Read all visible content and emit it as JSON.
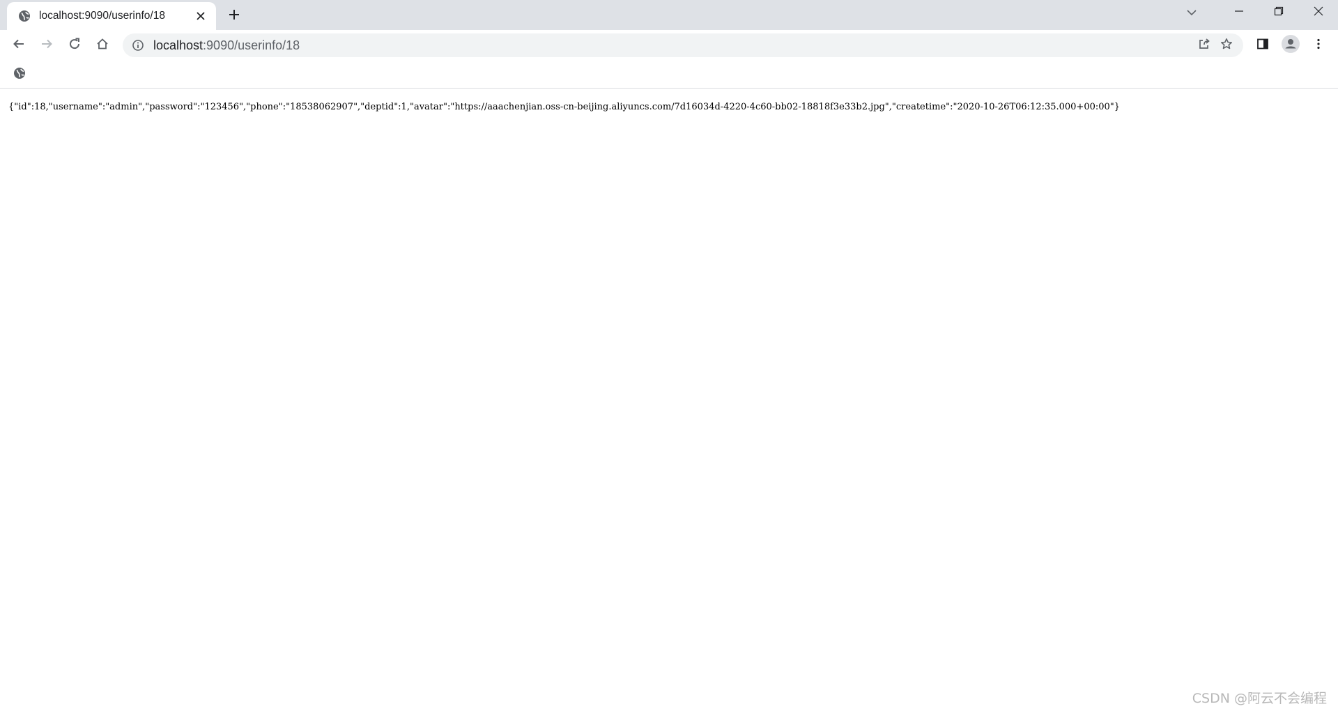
{
  "tab": {
    "title": "localhost:9090/userinfo/18"
  },
  "omnibox": {
    "host": "localhost",
    "rest": ":9090/userinfo/18"
  },
  "content": {
    "json": "{\"id\":18,\"username\":\"admin\",\"password\":\"123456\",\"phone\":\"18538062907\",\"deptid\":1,\"avatar\":\"https://aaachenjian.oss-cn-beijing.aliyuncs.com/7d16034d-4220-4c60-bb02-18818f3e33b2.jpg\",\"createtime\":\"2020-10-26T06:12:35.000+00:00\"}"
  },
  "watermark": "CSDN @阿云不会编程",
  "icons": {
    "favicon": "globe-icon",
    "close": "close-icon",
    "new_tab": "plus-icon",
    "back": "arrow-left-icon",
    "forward": "arrow-right-icon",
    "reload": "reload-icon",
    "home": "home-icon",
    "info": "info-icon",
    "share": "share-icon",
    "bookmark": "star-icon",
    "side_panel": "side-panel-icon",
    "profile": "profile-icon",
    "menu": "kebab-menu-icon"
  },
  "colors": {
    "tabstrip": "#dee1e6",
    "omnibox": "#f1f3f4",
    "icon": "#5f6368"
  }
}
